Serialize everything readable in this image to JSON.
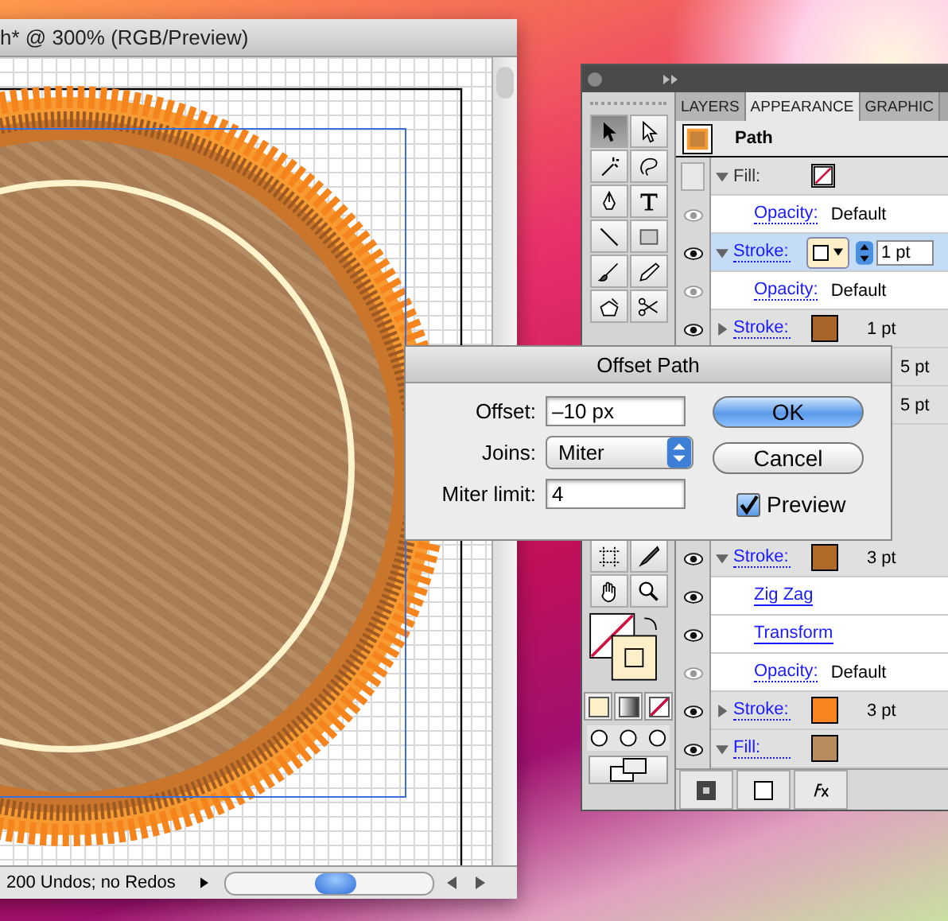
{
  "document": {
    "title": "h* @ 300% (RGB/Preview)",
    "status": "200 Undos; no Redos"
  },
  "tools_top": [
    {
      "kind": "select",
      "selected": true
    },
    {
      "kind": "direct",
      "selected": false
    },
    {
      "kind": "wand",
      "selected": false
    },
    {
      "kind": "lasso",
      "selected": false
    },
    {
      "kind": "pen",
      "selected": false
    },
    {
      "kind": "type",
      "selected": false
    },
    {
      "kind": "line",
      "selected": false
    },
    {
      "kind": "rect",
      "selected": false
    },
    {
      "kind": "brush",
      "selected": false
    },
    {
      "kind": "pencil",
      "selected": false
    },
    {
      "kind": "blob",
      "selected": false
    },
    {
      "kind": "scissors",
      "selected": false
    }
  ],
  "tools_bottom": [
    {
      "kind": "artboard",
      "selected": false
    },
    {
      "kind": "slice",
      "selected": false
    },
    {
      "kind": "hand",
      "selected": false
    },
    {
      "kind": "zoom",
      "selected": false
    }
  ],
  "panel": {
    "tabs": [
      {
        "label": "LAYERS",
        "selected": false
      },
      {
        "label": "APPEARANCE",
        "selected": true
      },
      {
        "label": "GRAPHIC",
        "selected": false
      }
    ],
    "target": "Path",
    "rows_above": [
      {
        "kind": "unset",
        "label": "Fill:",
        "eye": false,
        "expanded": true,
        "selected": false
      },
      {
        "kind": "opacity",
        "label": "Opacity:",
        "value": "Default",
        "eye": true,
        "dimmed": true,
        "selected": false
      },
      {
        "kind": "editing",
        "label": "Stroke:",
        "eye": true,
        "dimmed": false,
        "expanded": true,
        "color": "#fdf0c8",
        "value": "1 pt",
        "selected": true
      },
      {
        "kind": "opacity",
        "label": "Opacity:",
        "value": "Default",
        "eye": true,
        "dimmed": true,
        "selected": false
      },
      {
        "kind": "attribute",
        "label": "Stroke:",
        "eye": true,
        "dimmed": false,
        "expanded": false,
        "color": "#a8652a",
        "value": "1 pt",
        "selected": false
      },
      {
        "kind": "value",
        "value": "5 pt",
        "selected": false
      },
      {
        "kind": "value",
        "value": "5 pt",
        "selected": false
      }
    ],
    "rows_below": [
      {
        "kind": "attribute",
        "label": "Stroke:",
        "eye": true,
        "dimmed": false,
        "expanded": true,
        "color": "#b06a2a",
        "value": "3 pt",
        "selected": false
      },
      {
        "kind": "effect",
        "label": "Zig Zag",
        "eye": true,
        "dimmed": false,
        "selected": false
      },
      {
        "kind": "effect",
        "label": "Transform",
        "eye": true,
        "dimmed": false,
        "selected": false
      },
      {
        "kind": "opacity",
        "label": "Opacity:",
        "value": "Default",
        "eye": true,
        "dimmed": true,
        "selected": false
      },
      {
        "kind": "attribute",
        "label": "Stroke:",
        "eye": true,
        "dimmed": false,
        "expanded": false,
        "color": "#f7841e",
        "value": "3 pt",
        "selected": false
      },
      {
        "kind": "attribute",
        "label": "Fill:",
        "eye": true,
        "dimmed": false,
        "expanded": true,
        "color": "#b88b5e",
        "selected": false
      }
    ]
  },
  "dialog": {
    "title": "Offset Path",
    "fields": [
      {
        "kind": "text",
        "label": "Offset:",
        "value": "–10 px"
      },
      {
        "kind": "select",
        "label": "Joins:",
        "value": "Miter"
      },
      {
        "kind": "text",
        "label": "Miter limit:",
        "value": "4"
      }
    ],
    "buttons": [
      {
        "label": "OK",
        "default": true
      },
      {
        "label": "Cancel",
        "default": false
      }
    ],
    "preview": {
      "label": "Preview",
      "checked": true
    }
  }
}
